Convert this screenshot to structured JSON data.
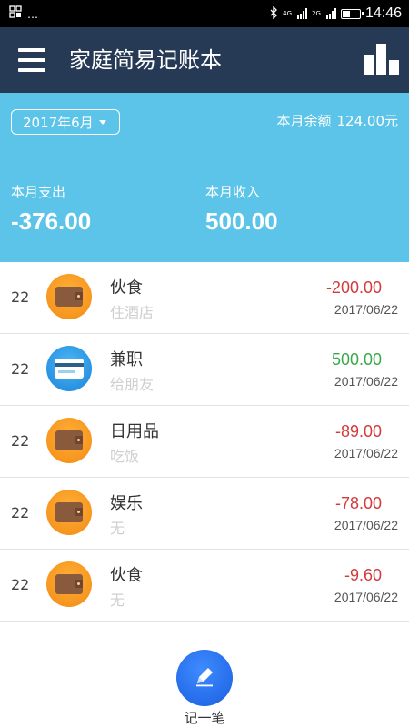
{
  "status_bar": {
    "left_text": "…",
    "network1": "4G",
    "network2": "2G",
    "time": "14:46"
  },
  "app_bar": {
    "title": "家庭简易记账本",
    "menu_icon": "hamburger-menu-icon",
    "stats_icon": "bar-chart-icon"
  },
  "summary": {
    "month": "2017年6月",
    "balance_label": "本月余额",
    "balance_value": "124.00元",
    "expense_label": "本月支出",
    "expense_value": "-376.00",
    "income_label": "本月收入",
    "income_value": "500.00"
  },
  "records": [
    {
      "day": "22",
      "icon": "wallet-icon",
      "category": "伙食",
      "note": "住酒店",
      "amount": "-200.00",
      "type": "expense",
      "date": "2017/06/22"
    },
    {
      "day": "22",
      "icon": "bank-card-icon",
      "category": "兼职",
      "note": "给朋友",
      "amount": "500.00",
      "type": "income",
      "date": "2017/06/22"
    },
    {
      "day": "22",
      "icon": "wallet-icon",
      "category": "日用品",
      "note": "吃饭",
      "amount": "-89.00",
      "type": "expense",
      "date": "2017/06/22"
    },
    {
      "day": "22",
      "icon": "wallet-icon",
      "category": "娱乐",
      "note": "无",
      "amount": "-78.00",
      "type": "expense",
      "date": "2017/06/22"
    },
    {
      "day": "22",
      "icon": "wallet-icon",
      "category": "伙食",
      "note": "无",
      "amount": "-9.60",
      "type": "expense",
      "date": "2017/06/22"
    }
  ],
  "bottom": {
    "add_label": "记一笔",
    "add_icon": "pencil-icon"
  },
  "colors": {
    "app_bar": "#263a56",
    "summary_bg": "#5bc4e8",
    "expense": "#d33a3a",
    "income": "#3aa84a",
    "add_button": "#2a72ee"
  }
}
